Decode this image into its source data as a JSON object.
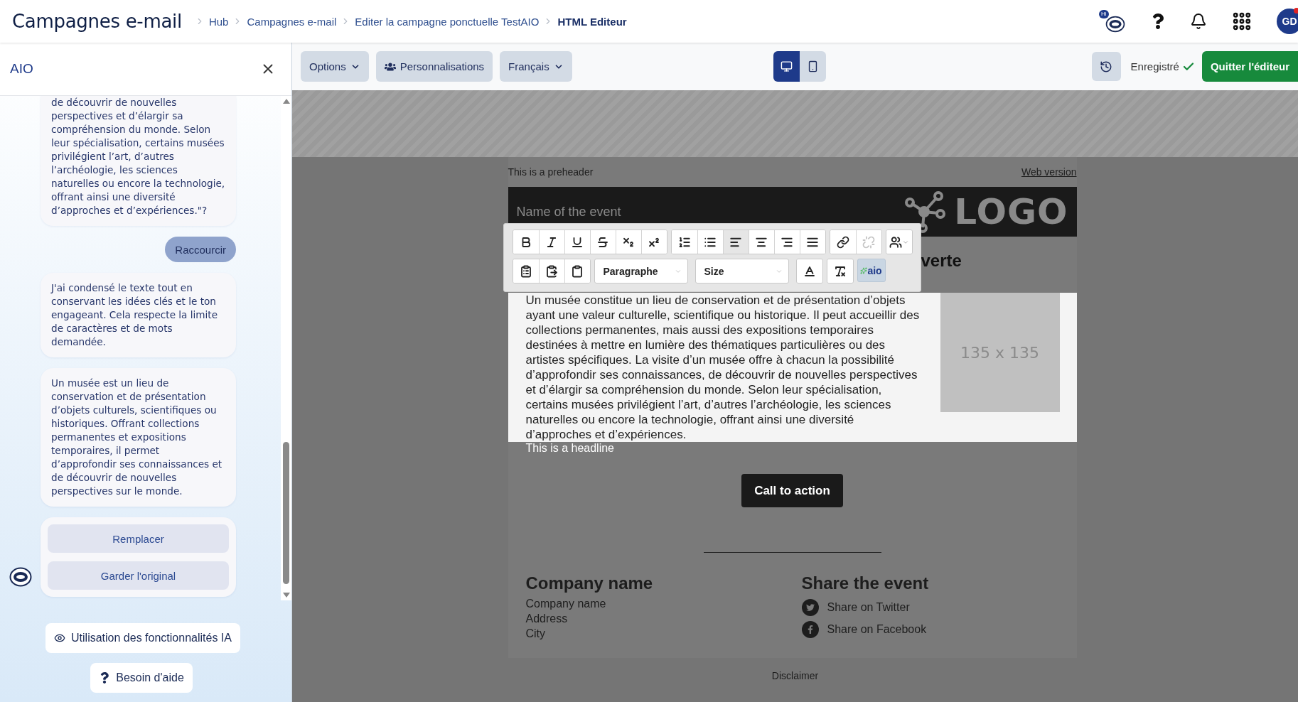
{
  "header": {
    "title": "Campagnes e-mail",
    "breadcrumbs": [
      {
        "label": "Hub",
        "current": false
      },
      {
        "label": "Campagnes e-mail",
        "current": false
      },
      {
        "label": "Editer la campagne ponctuelle TestAIO",
        "current": false
      },
      {
        "label": "HTML Editeur",
        "current": true
      }
    ],
    "assistant_badge": "Hi",
    "user": {
      "initials": "GD",
      "has_notification": true
    }
  },
  "panel": {
    "title": "AIO",
    "messages": [
      {
        "kind": "bot",
        "cut_top": true,
        "text": "de découvrir de nouvelles perspectives et d’élargir sa compréhension du monde. Selon leur spécialisation, certains musées privilégient l’art, d’autres l’archéologie, les sciences naturelles ou encore la technologie, offrant ainsi une diversité d’approches et d’expériences.\"?"
      },
      {
        "kind": "user",
        "text": "Raccourcir"
      },
      {
        "kind": "bot",
        "cut_top": false,
        "text": "J'ai condensé le texte tout en conservant les idées clés et le ton engageant. Cela respecte la limite de caractères et de mots demandée."
      },
      {
        "kind": "bot",
        "cut_top": false,
        "text": "Un musée est un lieu de conservation et de présentation d’objets culturels, scientifiques ou historiques. Offrant collections permanentes et expositions temporaires, il permet d’approfondir ses connaissances et de découvrir de nouvelles perspectives sur le monde."
      },
      {
        "kind": "actions",
        "buttons": [
          "Remplacer",
          "Garder l'original"
        ]
      }
    ],
    "footer_buttons": [
      {
        "kind": "info",
        "label": "Utilisation des fonctionnalités IA"
      },
      {
        "kind": "help",
        "label": "Besoin d'aide"
      }
    ]
  },
  "toolbar": {
    "menus": [
      {
        "kind": "dropdown",
        "label": "Options"
      },
      {
        "kind": "people",
        "label": "Personnalisations"
      },
      {
        "kind": "dropdown",
        "label": "Français"
      }
    ],
    "devices": [
      {
        "kind": "desktop",
        "selected": true
      },
      {
        "kind": "mobile",
        "selected": false
      }
    ],
    "save_status": "Enregistré",
    "quit": "Quitter l'éditeur"
  },
  "format_bar": {
    "rows": [
      [
        {
          "kind": "group",
          "buttons": [
            {
              "kind": "bold",
              "selected": false,
              "disabled": false
            },
            {
              "kind": "italic",
              "selected": false,
              "disabled": false
            },
            {
              "kind": "underline",
              "selected": false,
              "disabled": false
            },
            {
              "kind": "strike",
              "selected": false,
              "disabled": false
            },
            {
              "kind": "subscript",
              "selected": false,
              "disabled": false
            },
            {
              "kind": "superscript",
              "selected": false,
              "disabled": false
            }
          ]
        },
        {
          "kind": "group",
          "buttons": [
            {
              "kind": "ordered-list",
              "selected": false,
              "disabled": false
            },
            {
              "kind": "bullet-list",
              "selected": false,
              "disabled": false
            },
            {
              "kind": "align-left",
              "selected": true,
              "disabled": false
            },
            {
              "kind": "align-center",
              "selected": false,
              "disabled": false
            },
            {
              "kind": "align-right",
              "selected": false,
              "disabled": false
            },
            {
              "kind": "justify",
              "selected": false,
              "disabled": false
            }
          ]
        },
        {
          "kind": "group",
          "buttons": [
            {
              "kind": "link",
              "selected": false,
              "disabled": false
            },
            {
              "kind": "unlink",
              "selected": false,
              "disabled": true
            }
          ]
        },
        {
          "kind": "group",
          "buttons": [
            {
              "kind": "people",
              "selected": false,
              "disabled": false
            }
          ]
        }
      ],
      [
        {
          "kind": "group",
          "buttons": [
            {
              "kind": "paste",
              "selected": false,
              "disabled": false
            },
            {
              "kind": "paste-text",
              "selected": false,
              "disabled": false
            },
            {
              "kind": "paste-word",
              "selected": false,
              "disabled": false
            }
          ]
        },
        {
          "kind": "select",
          "label": "Paragraphe"
        },
        {
          "kind": "select",
          "label": "Size"
        },
        {
          "kind": "group",
          "buttons": [
            {
              "kind": "text-color",
              "selected": false,
              "disabled": false
            }
          ]
        },
        {
          "kind": "group",
          "buttons": [
            {
              "kind": "clear-format",
              "selected": false,
              "disabled": false
            }
          ]
        },
        {
          "kind": "ai",
          "label": "aio",
          "selected": true
        }
      ]
    ]
  },
  "email": {
    "preheader": "This is a preheader",
    "web_version": "Web version",
    "event_name": "Name of the event",
    "logo": "LOGO",
    "headline_fragment": "verte",
    "body": "Un musée constitue un lieu de conservation et de présentation d’objets ayant une valeur culturelle, scientifique ou historique. Il peut accueillir des collections permanentes, mais aussi des expositions temporaires destinées à mettre en lumière des thématiques particulières ou des artistes spécifiques. La visite d’un musée offre à chacun la possibilité d’approfondir ses connaissances, de découvrir de nouvelles perspectives et d’élargir sa compréhension du monde. Selon leur spécialisation, certains musées privilégient l’art, d’autres l’archéologie, les sciences naturelles ou encore la technologie, offrant ainsi une diversité d’approches et d’expériences.",
    "image_placeholder": "135 x 135",
    "headline": "This is a headline",
    "cta": "Call to action",
    "footer": {
      "company_title": "Company name",
      "company_lines": [
        "Company name",
        "Address",
        "City"
      ],
      "share_title": "Share the event",
      "share_links": [
        {
          "kind": "twitter",
          "label": "Share on Twitter"
        },
        {
          "kind": "facebook",
          "label": "Share on Facebook"
        }
      ]
    },
    "disclaimer": "Disclaimer"
  }
}
